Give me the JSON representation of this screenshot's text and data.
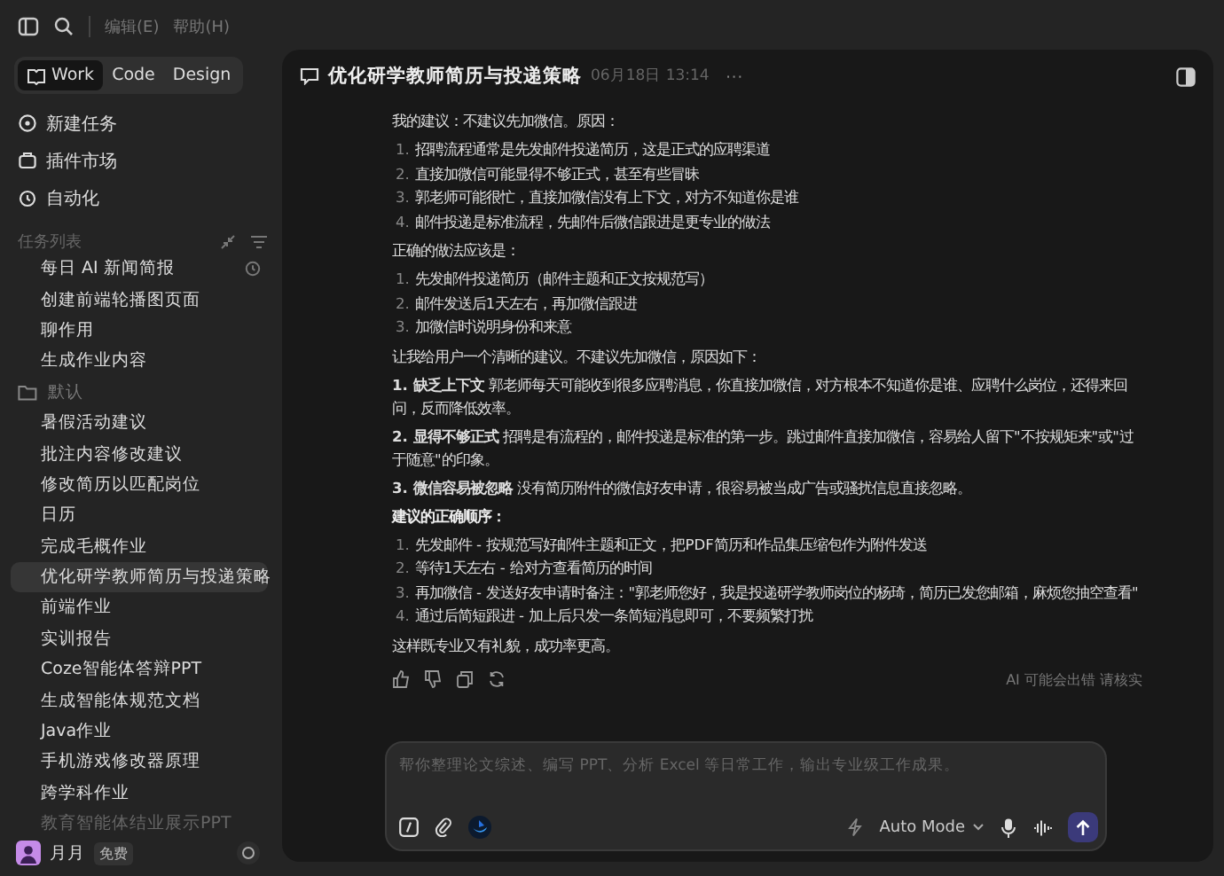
{
  "menu": [
    "编辑(E)",
    "帮助(H)"
  ],
  "mode_tabs": [
    {
      "label": "Work",
      "selected": true
    },
    {
      "label": "Code",
      "selected": false
    },
    {
      "label": "Design",
      "selected": false
    }
  ],
  "nav": [
    {
      "kind": "new",
      "label": "新建任务"
    },
    {
      "kind": "plugins",
      "label": "插件市场"
    },
    {
      "kind": "auto",
      "label": "自动化"
    }
  ],
  "task_list": {
    "title": "任务列表",
    "items": [
      {
        "kind": "task",
        "label": "每日 AI 新闻简报",
        "scheduled": true,
        "selected": false,
        "faded": false
      },
      {
        "kind": "task",
        "label": "创建前端轮播图页面",
        "scheduled": false,
        "selected": false,
        "faded": false
      },
      {
        "kind": "task",
        "label": "聊作用",
        "scheduled": false,
        "selected": false,
        "faded": false
      },
      {
        "kind": "task",
        "label": "生成作业内容",
        "scheduled": false,
        "selected": false,
        "faded": false
      },
      {
        "kind": "folder",
        "label": "默认",
        "selected": false
      },
      {
        "kind": "task",
        "label": "暑假活动建议",
        "scheduled": false,
        "selected": false,
        "faded": false
      },
      {
        "kind": "task",
        "label": "批注内容修改建议",
        "scheduled": false,
        "selected": false,
        "faded": false
      },
      {
        "kind": "task",
        "label": "修改简历以匹配岗位",
        "scheduled": false,
        "selected": false,
        "faded": false
      },
      {
        "kind": "task",
        "label": "日历",
        "scheduled": false,
        "selected": false,
        "faded": false
      },
      {
        "kind": "task",
        "label": "完成毛概作业",
        "scheduled": false,
        "selected": false,
        "faded": false
      },
      {
        "kind": "task",
        "label": "优化研学教师简历与投递策略",
        "scheduled": false,
        "selected": true,
        "faded": false
      },
      {
        "kind": "task",
        "label": "前端作业",
        "scheduled": false,
        "selected": false,
        "faded": false
      },
      {
        "kind": "task",
        "label": "实训报告",
        "scheduled": false,
        "selected": false,
        "faded": false
      },
      {
        "kind": "task",
        "label": "Coze智能体答辩PPT",
        "scheduled": false,
        "selected": false,
        "faded": false
      },
      {
        "kind": "task",
        "label": "生成智能体规范文档",
        "scheduled": false,
        "selected": false,
        "faded": false
      },
      {
        "kind": "task",
        "label": "Java作业",
        "scheduled": false,
        "selected": false,
        "faded": false
      },
      {
        "kind": "task",
        "label": "手机游戏修改器原理",
        "scheduled": false,
        "selected": false,
        "faded": false
      },
      {
        "kind": "task",
        "label": "跨学科作业",
        "scheduled": false,
        "selected": false,
        "faded": false
      },
      {
        "kind": "task",
        "label": "教育智能体结业展示PPT",
        "scheduled": false,
        "selected": false,
        "faded": true
      }
    ]
  },
  "user": {
    "name": "月月",
    "plan": "免费"
  },
  "chat": {
    "title": "优化研学教师简历与投递策略",
    "time": "06月18日 13:14",
    "more": "···",
    "blocks": [
      {
        "kind": "paragraph",
        "text": "我的建议：不建议先加微信。原因："
      },
      {
        "kind": "list",
        "items": [
          {
            "num": "1.",
            "text": "招聘流程通常是先发邮件投递简历，这是正式的应聘渠道"
          },
          {
            "num": "2.",
            "text": "直接加微信可能显得不够正式，甚至有些冒昧"
          },
          {
            "num": "3.",
            "text": "郭老师可能很忙，直接加微信没有上下文，对方不知道你是谁"
          },
          {
            "num": "4.",
            "text": "邮件投递是标准流程，先邮件后微信跟进是更专业的做法"
          }
        ]
      },
      {
        "kind": "paragraph",
        "text": "正确的做法应该是："
      },
      {
        "kind": "list",
        "items": [
          {
            "num": "1.",
            "text": "先发邮件投递简历（邮件主题和正文按规范写）"
          },
          {
            "num": "2.",
            "text": "邮件发送后1天左右，再加微信跟进"
          },
          {
            "num": "3.",
            "text": "加微信时说明身份和来意"
          }
        ]
      },
      {
        "kind": "paragraph",
        "text": "让我给用户一个清晰的建议。不建议先加微信，原因如下："
      },
      {
        "kind": "paragraph",
        "text": "**1. 缺乏上下文** 郭老师每天可能收到很多应聘消息，你直接加微信，对方根本不知道你是谁、应聘什么岗位，还得来回问，反而降低效率。"
      },
      {
        "kind": "paragraph",
        "text": "**2. 显得不够正式** 招聘是有流程的，邮件投递是标准的第一步。跳过邮件直接加微信，容易给人留下\"不按规矩来\"或\"过于随意\"的印象。"
      },
      {
        "kind": "paragraph",
        "text": "**3. 微信容易被忽略** 没有简历附件的微信好友申请，很容易被当成广告或骚扰信息直接忽略。"
      },
      {
        "kind": "heading",
        "text": "建议的正确顺序："
      },
      {
        "kind": "list",
        "items": [
          {
            "num": "1.",
            "text": "先发邮件 - 按规范写好邮件主题和正文，把PDF简历和作品集压缩包作为附件发送"
          },
          {
            "num": "2.",
            "text": "等待1天左右 - 给对方查看简历的时间"
          },
          {
            "num": "3.",
            "text": "再加微信 - 发送好友申请时备注：\"郭老师您好，我是投递研学教师岗位的杨琦，简历已发您邮箱，麻烦您抽空查看\""
          },
          {
            "num": "4.",
            "text": "通过后简短跟进 - 加上后只发一条简短消息即可，不要频繁打扰"
          }
        ]
      },
      {
        "kind": "paragraph",
        "text": "这样既专业又有礼貌，成功率更高。"
      }
    ],
    "disclaimer": "AI 可能会出错 请核实"
  },
  "composer": {
    "placeholder": "帮你整理论文综述、编写 PPT、分析 Excel 等日常工作，输出专业级工作成果。",
    "mode": "Auto Mode"
  }
}
